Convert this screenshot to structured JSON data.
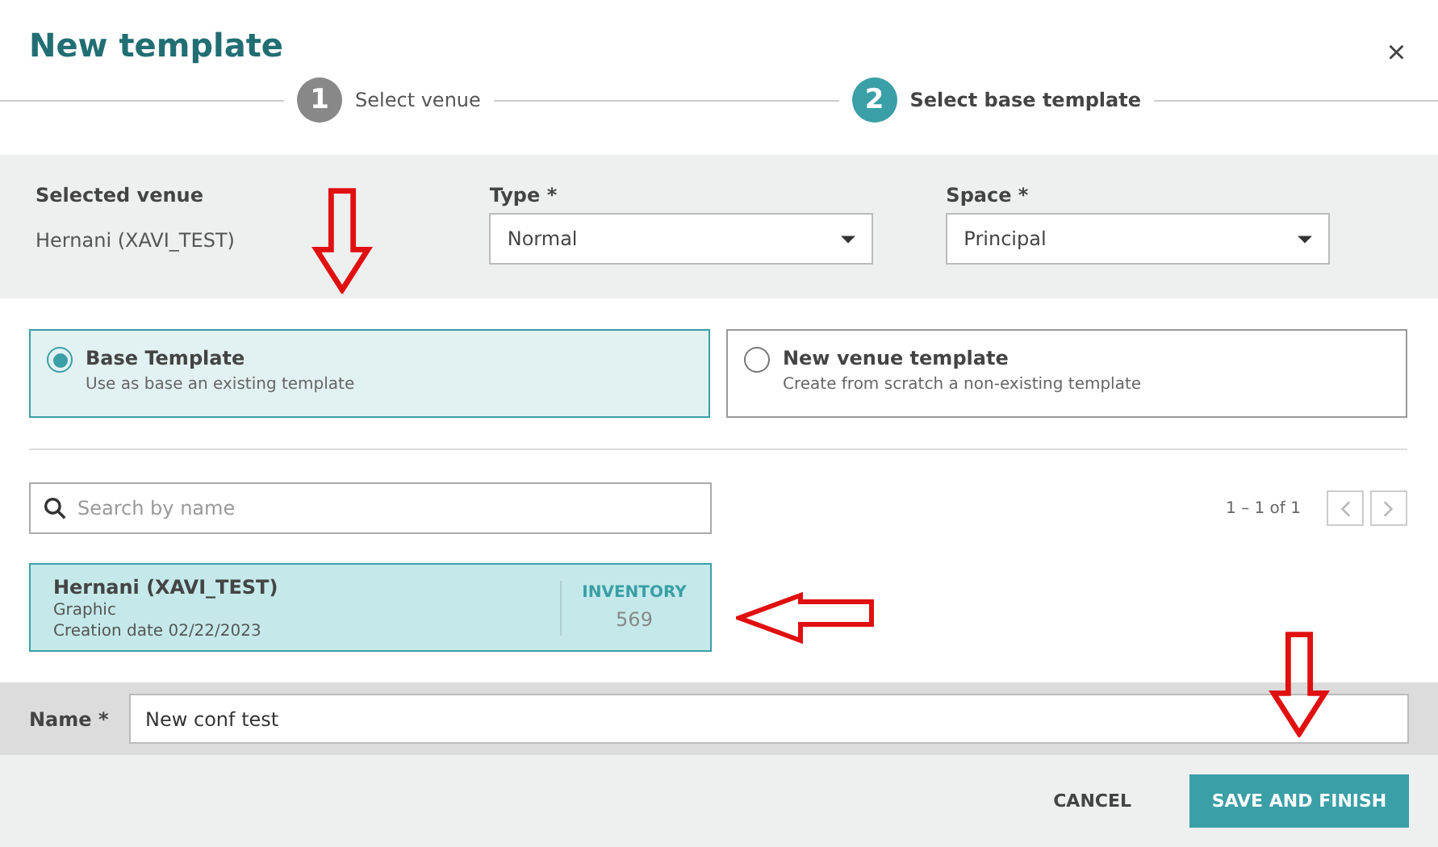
{
  "dialog": {
    "title": "New template",
    "close": "×"
  },
  "steps": [
    {
      "number": "1",
      "label": "Select venue",
      "selected": false
    },
    {
      "number": "2",
      "label": "Select base template",
      "selected": true
    }
  ],
  "filters": {
    "venue_label": "Selected venue",
    "venue_value": "Hernani (XAVI_TEST)",
    "type": {
      "label": "Type *",
      "value": "Normal"
    },
    "space": {
      "label": "Space *",
      "value": "Principal"
    }
  },
  "options": [
    {
      "title": "Base Template",
      "description": "Use as base an existing template",
      "selected": true
    },
    {
      "title": "New venue template",
      "description": "Create from scratch a non-existing template",
      "selected": false
    }
  ],
  "search": {
    "placeholder": "Search by name"
  },
  "pagination": {
    "range": "1 – 1 of 1"
  },
  "results": [
    {
      "name": "Hernani (XAVI_TEST)",
      "kind": "Graphic",
      "date": "Creation date 02/22/2023",
      "stat_label": "INVENTORY",
      "stat_value": "569",
      "selected": true
    }
  ],
  "name_field": {
    "label": "Name *",
    "value": "New conf test"
  },
  "buttons": [
    {
      "label": "CANCEL",
      "kind": "text"
    },
    {
      "label": "SAVE AND FINISH",
      "kind": "primary"
    }
  ],
  "annotations": [
    {
      "kind": "down"
    },
    {
      "kind": "left"
    },
    {
      "kind": "down"
    }
  ]
}
